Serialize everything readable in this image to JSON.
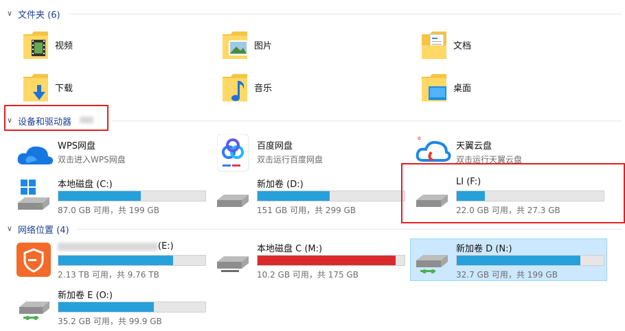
{
  "sections": {
    "folders": "文件夹 (6)",
    "devices": "设备和驱动器",
    "network": "网络位置 (4)"
  },
  "folders": [
    {
      "label": "视频",
      "icon": "video-folder-icon"
    },
    {
      "label": "图片",
      "icon": "pictures-folder-icon"
    },
    {
      "label": "文档",
      "icon": "documents-folder-icon"
    },
    {
      "label": "下载",
      "icon": "downloads-folder-icon"
    },
    {
      "label": "音乐",
      "icon": "music-folder-icon"
    },
    {
      "label": "桌面",
      "icon": "desktop-folder-icon"
    }
  ],
  "apps": [
    {
      "name": "WPS网盘",
      "sub": "双击进入WPS网盘",
      "icon": "wps-cloud-icon"
    },
    {
      "name": "百度网盘",
      "sub": "双击运行百度网盘",
      "icon": "baidu-netdisk-icon"
    },
    {
      "name": "天翼云盘",
      "sub": "双击运行天翼云盘",
      "icon": "tianyi-cloud-icon"
    }
  ],
  "drives": [
    {
      "name": "本地磁盘 (C:)",
      "cap": "87.0 GB 可用，共 199 GB",
      "used": 0.56,
      "color": "#26a0da"
    },
    {
      "name": "新加卷 (D:)",
      "cap": "151 GB 可用，共 299 GB",
      "used": 0.49,
      "color": "#26a0da"
    },
    {
      "name": "LI (F:)",
      "cap": "22.0 GB 可用，共 27.3 GB",
      "used": 0.19,
      "color": "#26a0da"
    }
  ],
  "network": [
    {
      "name": "(E:)",
      "cap": "2.13 TB 可用，共 9.76 TB",
      "used": 0.78,
      "color": "#26a0da"
    },
    {
      "name": "本地磁盘 C (M:)",
      "cap": "10.2 GB 可用，共 175 GB",
      "used": 0.94,
      "color": "#d92b2b"
    },
    {
      "name": "新加卷 D (N:)",
      "cap": "32.7 GB 可用，共 199 GB",
      "used": 0.84,
      "color": "#26a0da"
    },
    {
      "name": "新加卷 E (O:)",
      "cap": "35.2 GB 可用，共 99.9 GB",
      "used": 0.65,
      "color": "#26a0da"
    }
  ]
}
